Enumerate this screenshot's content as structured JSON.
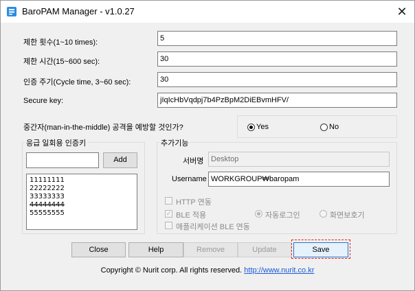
{
  "window": {
    "title": "BaroPAM Manager - v1.0.27"
  },
  "settings": {
    "limit_count_label": "제한 횟수(1~10 times):",
    "limit_count_value": "5",
    "limit_time_label": "제한 시간(15~600 sec):",
    "limit_time_value": "30",
    "cycle_label": "인증 주기(Cycle time, 3~60 sec):",
    "cycle_value": "30",
    "secure_key_label": "Secure key:",
    "secure_key_value": "jIqIcHbVqdpj7b4PzBpM2DiEBvmHFV/"
  },
  "mitm": {
    "question": "중간자(man-in-the-middle) 공격을 예방할 것인가?",
    "yes_label": "Yes",
    "no_label": "No",
    "selected": "Yes"
  },
  "emergency": {
    "title": "응급 일회용 인증키",
    "input_value": "",
    "add_label": "Add",
    "keys": [
      "11111111",
      "22222222",
      "33333333",
      "44444444",
      "55555555"
    ]
  },
  "extra": {
    "title": "추가기능",
    "server_label": "서버명",
    "server_value": "Desktop",
    "username_label": "Username",
    "username_value": "WORKGROUP₩baropam",
    "http_label": "HTTP 연동",
    "ble_label": "BLE 적용",
    "autologin_label": "자동로그인",
    "screensaver_label": "화면보호기",
    "app_ble_label": "애플리케이션 BLE 연동"
  },
  "buttons": {
    "close": "Close",
    "help": "Help",
    "remove": "Remove",
    "update": "Update",
    "save": "Save"
  },
  "footer": {
    "copyright": "Copyright © Nurit corp. All rights reserved.",
    "url": "http://www.nurit.co.kr"
  },
  "colors": {
    "highlight": "#e02020",
    "link": "#1a5ad6",
    "app_icon": "#2a8de0"
  }
}
